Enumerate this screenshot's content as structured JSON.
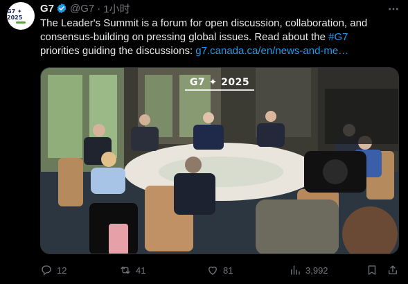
{
  "author": {
    "display_name": "G7",
    "handle": "@G7",
    "separator": "·",
    "time": "1小时",
    "avatar_text": "G7 ✦ 2025"
  },
  "tweet": {
    "line1": "The Leader's Summit is a forum for open discussion, collaboration, and",
    "line2": "consensus-building on pressing global issues. Read about the ",
    "hashtag": "#G7",
    "line3": "priorities guiding the discussions: ",
    "link": "g7.canada.ca/en/news-and-me…"
  },
  "media": {
    "banner": "G7 ✦ 2025"
  },
  "actions": {
    "replies": "12",
    "reposts": "41",
    "likes": "81",
    "views": "3,992"
  },
  "colors": {
    "background": "#000000",
    "text": "#e7e9ea",
    "muted": "#71767b",
    "accent": "#1d9bf0",
    "verified": "#1d9bf0"
  },
  "icons": [
    "verified-icon",
    "more-icon",
    "reply-icon",
    "repost-icon",
    "like-icon",
    "views-icon",
    "bookmark-icon",
    "share-icon"
  ]
}
